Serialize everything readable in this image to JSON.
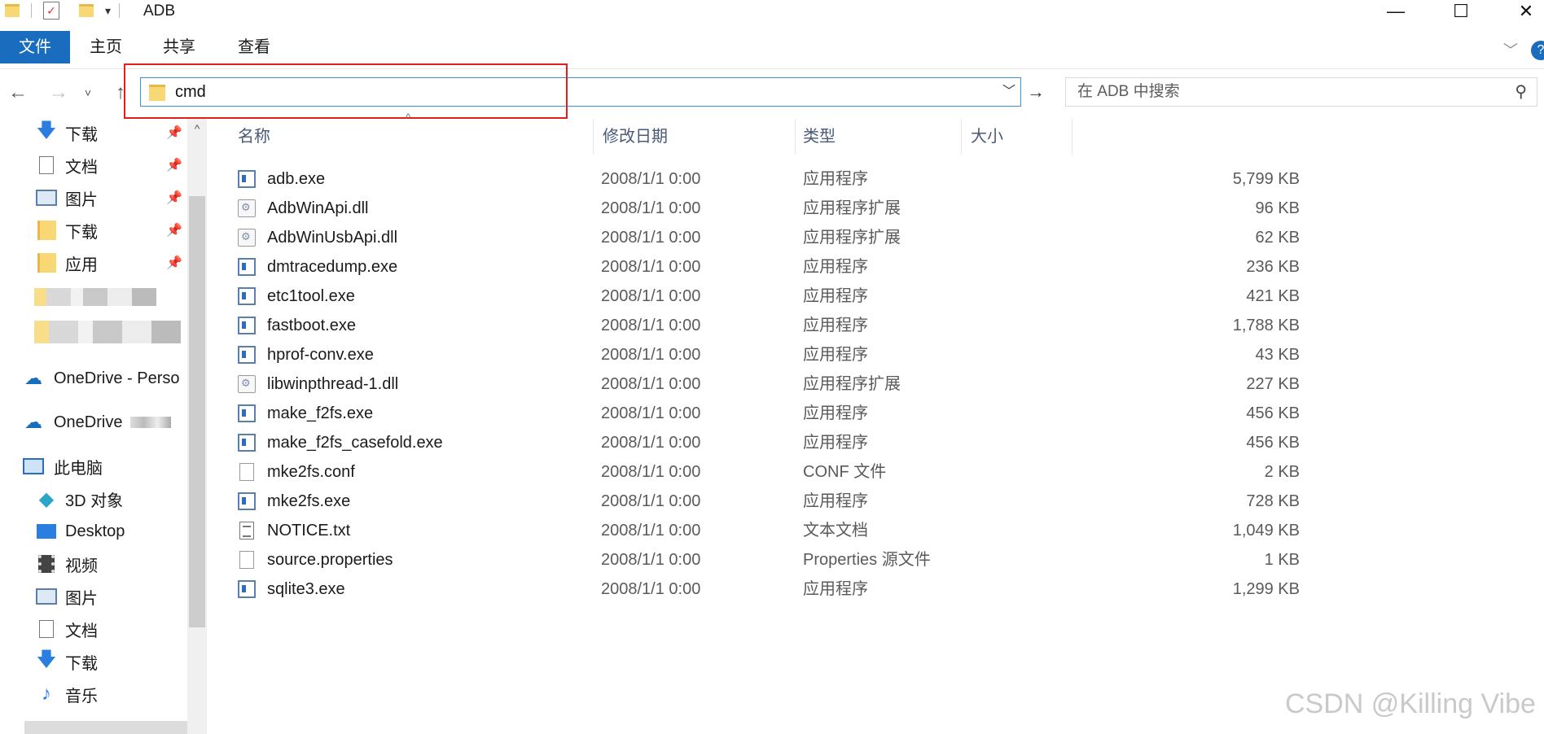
{
  "window": {
    "title": "ADB",
    "minimize": "—",
    "maximize": "☐",
    "close": "✕"
  },
  "ribbon": {
    "tabs": [
      "文件",
      "主页",
      "共享",
      "查看"
    ]
  },
  "address": {
    "value": "cmd",
    "search_placeholder": "在 ADB 中搜索"
  },
  "nav_pane": {
    "quick_access": [
      {
        "label": "下载",
        "icon": "download-arrow-icon",
        "pinned": true
      },
      {
        "label": "文档",
        "icon": "document-icon",
        "pinned": true
      },
      {
        "label": "图片",
        "icon": "picture-icon",
        "pinned": true
      },
      {
        "label": "下载",
        "icon": "folder-icon",
        "pinned": true
      },
      {
        "label": "应用",
        "icon": "folder-icon",
        "pinned": true
      }
    ],
    "onedrive": [
      {
        "label": "OneDrive - Perso"
      },
      {
        "label": "OneDrive"
      }
    ],
    "this_pc": {
      "label": "此电脑"
    },
    "pc_items": [
      {
        "label": "3D 对象",
        "icon": "3d-objects-icon"
      },
      {
        "label": "Desktop",
        "icon": "desktop-icon"
      },
      {
        "label": "视频",
        "icon": "video-icon"
      },
      {
        "label": "图片",
        "icon": "picture-icon"
      },
      {
        "label": "文档",
        "icon": "document-icon"
      },
      {
        "label": "下载",
        "icon": "download-arrow-icon"
      },
      {
        "label": "音乐",
        "icon": "music-note-icon"
      }
    ]
  },
  "columns": {
    "name": "名称",
    "date": "修改日期",
    "type": "类型",
    "size": "大小"
  },
  "files": [
    {
      "name": "adb.exe",
      "date": "2008/1/1 0:00",
      "type": "应用程序",
      "size": "5,799 KB",
      "kind": "exe"
    },
    {
      "name": "AdbWinApi.dll",
      "date": "2008/1/1 0:00",
      "type": "应用程序扩展",
      "size": "96 KB",
      "kind": "dll"
    },
    {
      "name": "AdbWinUsbApi.dll",
      "date": "2008/1/1 0:00",
      "type": "应用程序扩展",
      "size": "62 KB",
      "kind": "dll"
    },
    {
      "name": "dmtracedump.exe",
      "date": "2008/1/1 0:00",
      "type": "应用程序",
      "size": "236 KB",
      "kind": "exe"
    },
    {
      "name": "etc1tool.exe",
      "date": "2008/1/1 0:00",
      "type": "应用程序",
      "size": "421 KB",
      "kind": "exe"
    },
    {
      "name": "fastboot.exe",
      "date": "2008/1/1 0:00",
      "type": "应用程序",
      "size": "1,788 KB",
      "kind": "exe"
    },
    {
      "name": "hprof-conv.exe",
      "date": "2008/1/1 0:00",
      "type": "应用程序",
      "size": "43 KB",
      "kind": "exe"
    },
    {
      "name": "libwinpthread-1.dll",
      "date": "2008/1/1 0:00",
      "type": "应用程序扩展",
      "size": "227 KB",
      "kind": "dll"
    },
    {
      "name": "make_f2fs.exe",
      "date": "2008/1/1 0:00",
      "type": "应用程序",
      "size": "456 KB",
      "kind": "exe"
    },
    {
      "name": "make_f2fs_casefold.exe",
      "date": "2008/1/1 0:00",
      "type": "应用程序",
      "size": "456 KB",
      "kind": "exe"
    },
    {
      "name": "mke2fs.conf",
      "date": "2008/1/1 0:00",
      "type": "CONF 文件",
      "size": "2 KB",
      "kind": "doc"
    },
    {
      "name": "mke2fs.exe",
      "date": "2008/1/1 0:00",
      "type": "应用程序",
      "size": "728 KB",
      "kind": "exe"
    },
    {
      "name": "NOTICE.txt",
      "date": "2008/1/1 0:00",
      "type": "文本文档",
      "size": "1,049 KB",
      "kind": "txt"
    },
    {
      "name": "source.properties",
      "date": "2008/1/1 0:00",
      "type": "Properties 源文件",
      "size": "1 KB",
      "kind": "doc"
    },
    {
      "name": "sqlite3.exe",
      "date": "2008/1/1 0:00",
      "type": "应用程序",
      "size": "1,299 KB",
      "kind": "exe"
    }
  ],
  "watermark": "CSDN @Killing Vibe",
  "colors": {
    "accent": "#1a6cbf",
    "highlight_box": "#e02020",
    "folder": "#f8d775"
  }
}
